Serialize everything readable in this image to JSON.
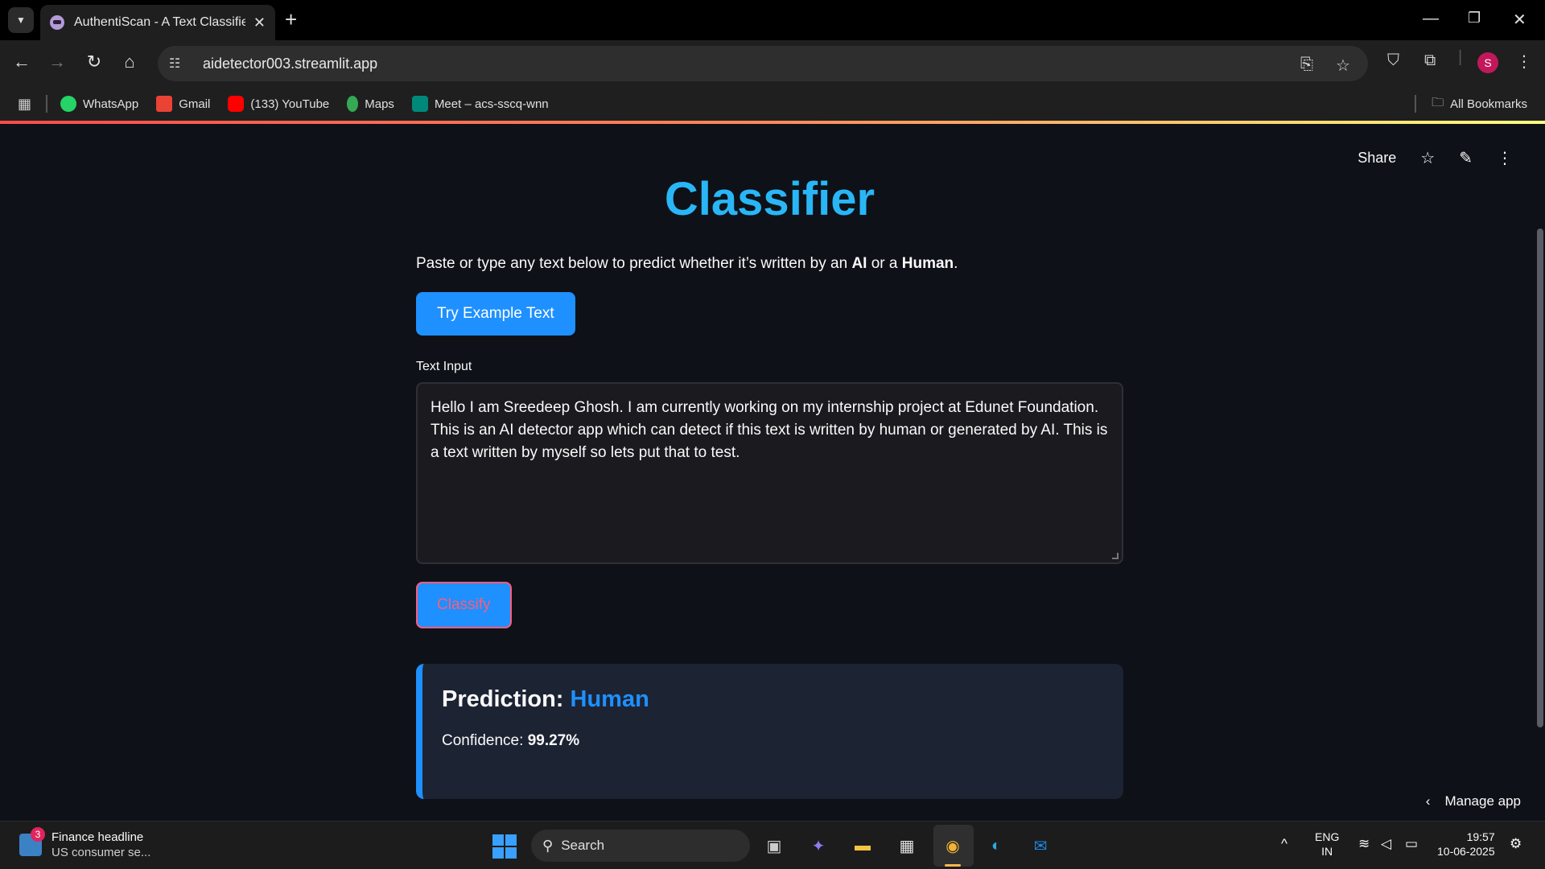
{
  "browser": {
    "tab_title": "AuthentiScan - A Text Classifier",
    "url": "aidetector003.streamlit.app",
    "bookmarks": [
      {
        "label": "WhatsApp",
        "color": "#25d366"
      },
      {
        "label": "Gmail",
        "color": "#ea4335"
      },
      {
        "label": "(133) YouTube",
        "color": "#ff0000"
      },
      {
        "label": "Maps",
        "color": "#34a853"
      },
      {
        "label": "Meet – acs-sscq-wnn",
        "color": "#00897b"
      }
    ],
    "all_bookmarks": "All Bookmarks",
    "profile_initial": "S"
  },
  "app": {
    "header": {
      "share": "Share"
    },
    "title": "Classifier",
    "intro_prefix": "Paste or type any text below to predict whether it’s written by an ",
    "intro_ai": "AI",
    "intro_mid": " or a ",
    "intro_human": "Human",
    "intro_suffix": ".",
    "example_button": "Try Example Text",
    "input_label": "Text Input",
    "input_value": "Hello I am Sreedeep Ghosh. I am currently working on my internship project at Edunet Foundation. This is an AI detector app which can detect if this text is written by human or generated by AI. This is a text written by myself so lets put that to test.",
    "classify_button": "Classify",
    "prediction_label": "Prediction: ",
    "prediction_value": "Human",
    "confidence_label": "Confidence: ",
    "confidence_value": "99.27%",
    "manage_app": "Manage app"
  },
  "taskbar": {
    "news_badge": "3",
    "news_title": "Finance headline",
    "news_sub": "US consumer se...",
    "search_placeholder": "Search",
    "lang_top": "ENG",
    "lang_bottom": "IN",
    "time": "19:57",
    "date": "10-06-2025"
  },
  "colors": {
    "accent_blue": "#1e90ff",
    "title_blue": "#29b6f6",
    "background": "#0e1117"
  }
}
